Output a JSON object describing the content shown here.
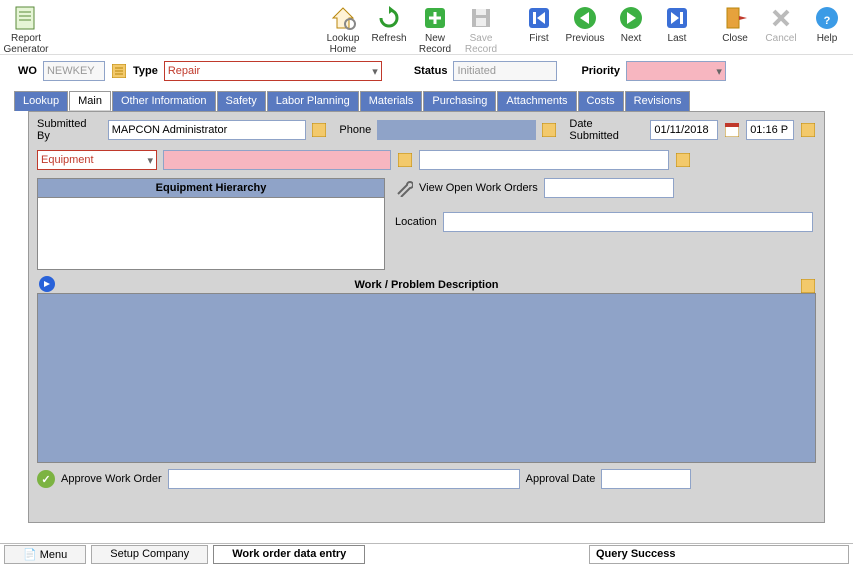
{
  "toolbar": {
    "report_generator": "Report\nGenerator",
    "lookup_home": "Lookup\nHome",
    "refresh": "Refresh",
    "new_record": "New\nRecord",
    "save_record": "Save\nRecord",
    "first": "First",
    "previous": "Previous",
    "next": "Next",
    "last": "Last",
    "close": "Close",
    "cancel": "Cancel",
    "help": "Help"
  },
  "header": {
    "wo_label": "WO",
    "wo_value": "NEWKEY",
    "type_label": "Type",
    "type_value": "Repair",
    "status_label": "Status",
    "status_value": "Initiated",
    "priority_label": "Priority",
    "priority_value": ""
  },
  "tabs": [
    "Lookup",
    "Main",
    "Other Information",
    "Safety",
    "Labor Planning",
    "Materials",
    "Purchasing",
    "Attachments",
    "Costs",
    "Revisions"
  ],
  "active_tab": "Main",
  "form": {
    "submitted_by_label": "Submitted By",
    "submitted_by_value": "MAPCON Administrator",
    "phone_label": "Phone",
    "phone_value": "",
    "date_submitted_label": "Date Submitted",
    "date_submitted_value": "01/11/2018",
    "time_submitted_value": "01:16 P",
    "entity_type": "Equipment",
    "entity_value": "",
    "entity_desc": "",
    "equipment_hierarchy_title": "Equipment Hierarchy",
    "view_open_wo": "View Open Work Orders",
    "view_open_wo_value": "",
    "location_label": "Location",
    "location_value": "",
    "wpd_title": "Work / Problem Description",
    "wpd_value": "",
    "approve_label": "Approve Work Order",
    "approve_value": "",
    "approval_date_label": "Approval Date",
    "approval_date_value": ""
  },
  "statusbar": {
    "menu": "Menu",
    "setup": "Setup Company",
    "wo_entry": "Work order data entry",
    "status": "Query Success"
  }
}
